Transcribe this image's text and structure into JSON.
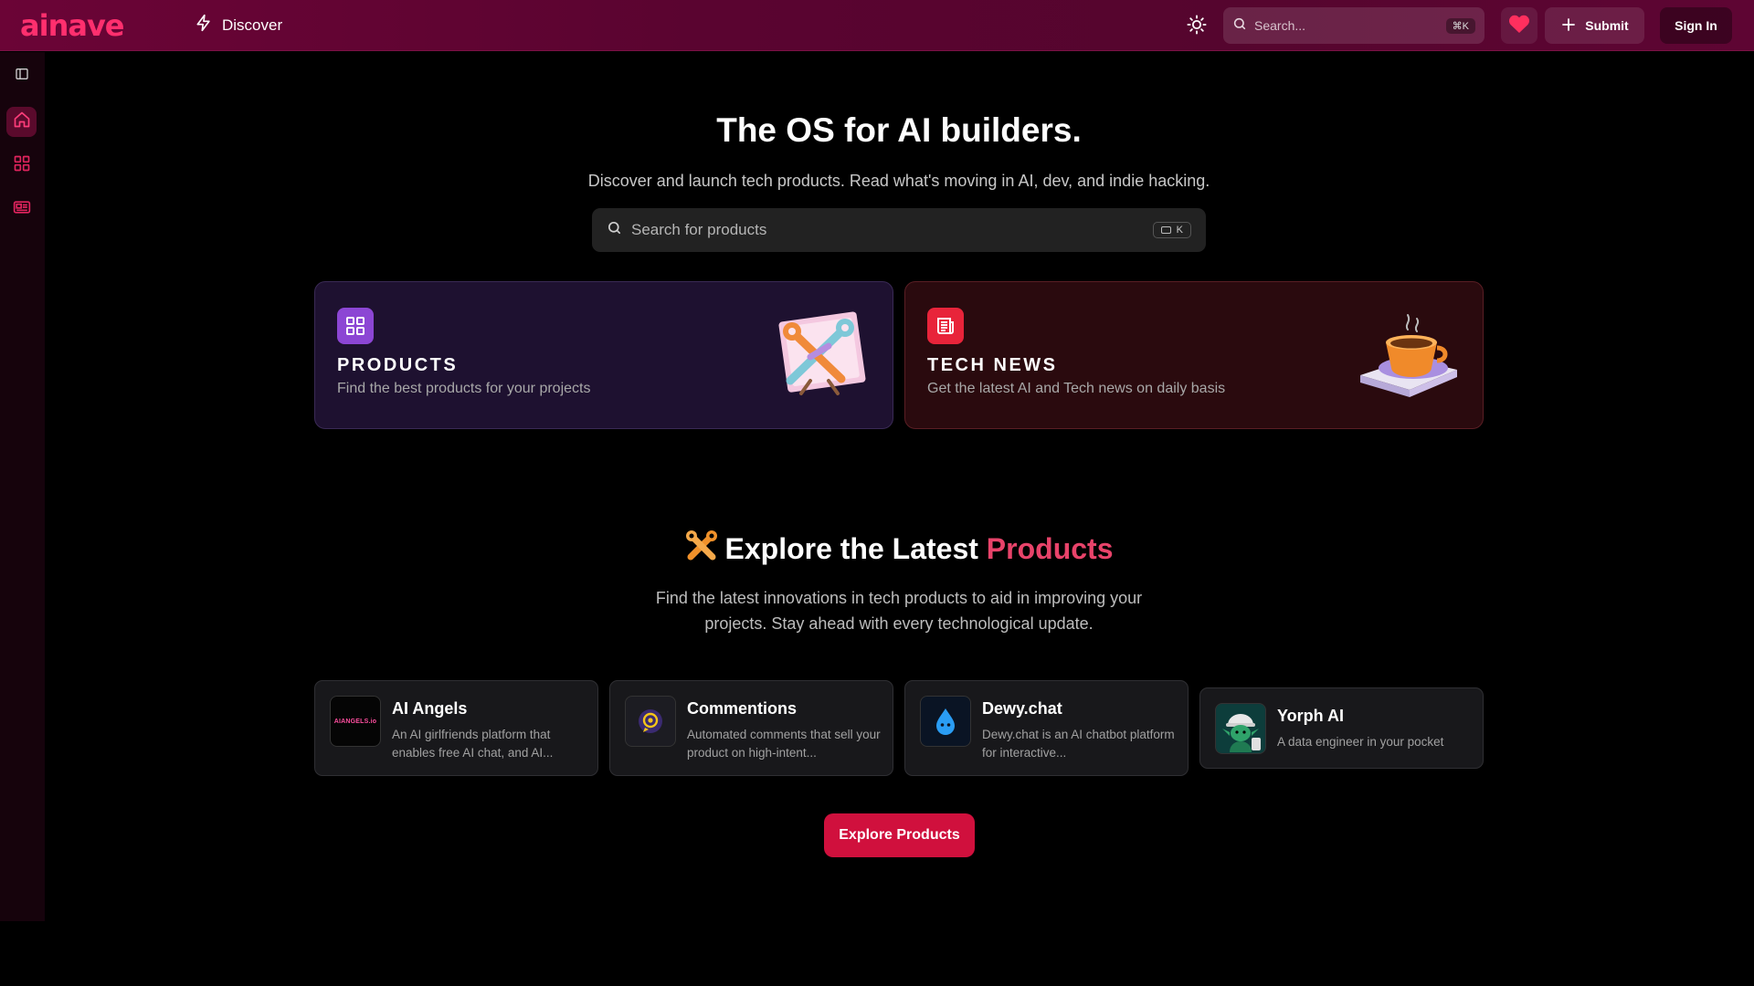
{
  "topbar": {
    "logo": "ainave",
    "discover_label": "Discover",
    "search_placeholder": "Search...",
    "search_shortcut": "⌘K",
    "submit_label": "Submit",
    "signin_label": "Sign In"
  },
  "sidebar": {
    "items": [
      {
        "icon": "sidebar-toggle-icon"
      },
      {
        "icon": "home-icon",
        "active": true
      },
      {
        "icon": "grid-icon"
      },
      {
        "icon": "newspaper-icon"
      }
    ]
  },
  "hero": {
    "title": "The OS for AI builders.",
    "subtitle": "Discover and launch tech products. Read what's moving in AI, dev, and indie hacking.",
    "search_placeholder": "Search for products",
    "search_shortcut": "K"
  },
  "features": [
    {
      "title": "PRODUCTS",
      "description": "Find the best products for your projects",
      "icon": "grid-icon",
      "art": "tools-icon",
      "accent": "#8c46d4"
    },
    {
      "title": "TECH NEWS",
      "description": "Get the latest AI and Tech news on daily basis",
      "icon": "newspaper-icon",
      "art": "coffee-cup-icon",
      "accent": "#e8243a"
    }
  ],
  "explore": {
    "title_prefix": "Explore the Latest ",
    "title_highlight": "Products",
    "subtitle": "Find the latest innovations in tech products to aid in improving your projects. Stay ahead with every technological update.",
    "button_label": "Explore Products"
  },
  "products": [
    {
      "name": "AI Angels",
      "description": "An AI girlfriends platform that enables free AI chat, and AI...",
      "logo_text": "AIANGELS.io"
    },
    {
      "name": "Commentions",
      "description": "Automated comments that sell your product on high-intent...",
      "logo_text": ""
    },
    {
      "name": "Dewy.chat",
      "description": "Dewy.chat is an AI chatbot platform for interactive...",
      "logo_text": ""
    },
    {
      "name": "Yorph AI",
      "description": "A data engineer in your pocket",
      "logo_text": ""
    }
  ],
  "colors": {
    "brand": "#ff2f6e",
    "cta": "#d0103d",
    "highlight": "#e8436a"
  }
}
